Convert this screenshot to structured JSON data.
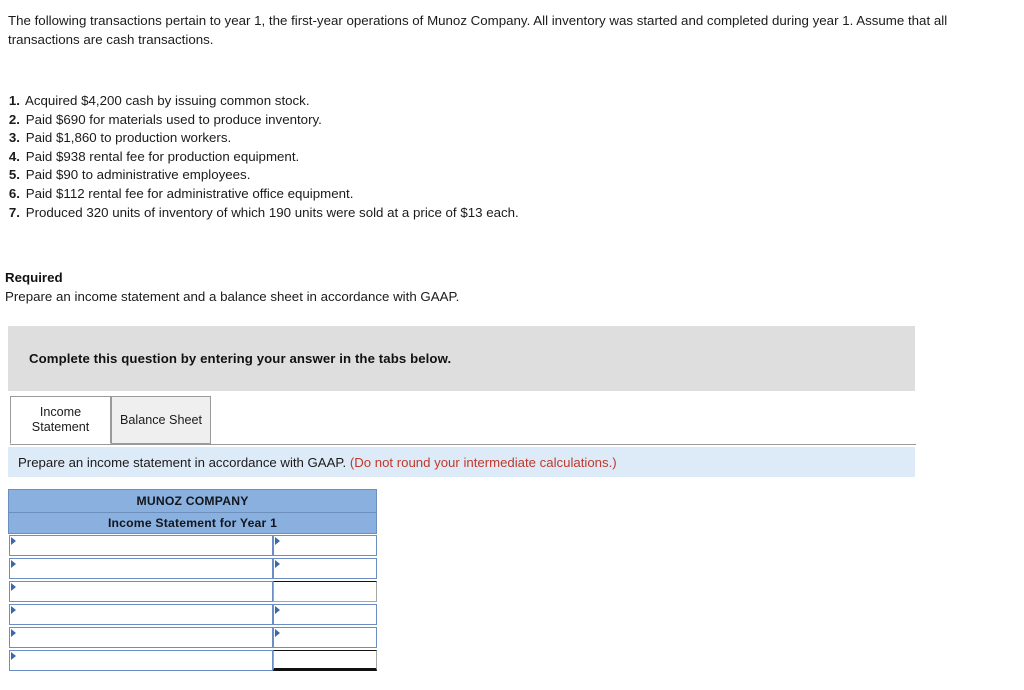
{
  "intro": {
    "paragraph": "The following transactions pertain to year 1, the first-year operations of Munoz Company. All inventory was started and completed during year 1. Assume that all transactions are cash transactions."
  },
  "transactions": [
    {
      "num": "1.",
      "text": "Acquired $4,200 cash by issuing common stock."
    },
    {
      "num": "2.",
      "text": "Paid $690 for materials used to produce inventory."
    },
    {
      "num": "3.",
      "text": "Paid $1,860 to production workers."
    },
    {
      "num": "4.",
      "text": "Paid $938 rental fee for production equipment."
    },
    {
      "num": "5.",
      "text": "Paid $90 to administrative employees."
    },
    {
      "num": "6.",
      "text": "Paid $112 rental fee for administrative office equipment."
    },
    {
      "num": "7.",
      "text": "Produced 320 units of inventory of which 190 units were sold at a price of $13 each."
    }
  ],
  "required": {
    "heading": "Required",
    "text": "Prepare an income statement and a balance sheet in accordance with GAAP."
  },
  "banner": {
    "text": "Complete this question by entering your answer in the tabs below."
  },
  "tabs": [
    {
      "label": "Income Statement",
      "active": true
    },
    {
      "label": "Balance Sheet",
      "active": false
    }
  ],
  "instruction": {
    "text": "Prepare an income statement in accordance with GAAP.",
    "note": "(Do not round your intermediate calculations.)",
    "note_color": "#c0392b"
  },
  "statement": {
    "company": "MUNOZ COMPANY",
    "subtitle": "Income Statement for Year 1",
    "rows": [
      {
        "label": "",
        "amount": "",
        "label_dropdown": true,
        "amount_dropdown": true,
        "amount_style": "input"
      },
      {
        "label": "",
        "amount": "",
        "label_dropdown": true,
        "amount_dropdown": true,
        "amount_style": "input"
      },
      {
        "label": "",
        "amount": "",
        "label_dropdown": true,
        "amount_dropdown": false,
        "amount_style": "subtotal"
      },
      {
        "label": "",
        "amount": "",
        "label_dropdown": true,
        "amount_dropdown": true,
        "amount_style": "input"
      },
      {
        "label": "",
        "amount": "",
        "label_dropdown": true,
        "amount_dropdown": true,
        "amount_style": "input"
      },
      {
        "label": "",
        "amount": "",
        "label_dropdown": true,
        "amount_dropdown": false,
        "amount_style": "total"
      }
    ]
  },
  "colors": {
    "header_blue": "#8ab0e0",
    "input_border_blue": "#6b8fc4",
    "banner_grey": "#dedede",
    "instruction_blue": "#ddeaf7"
  }
}
